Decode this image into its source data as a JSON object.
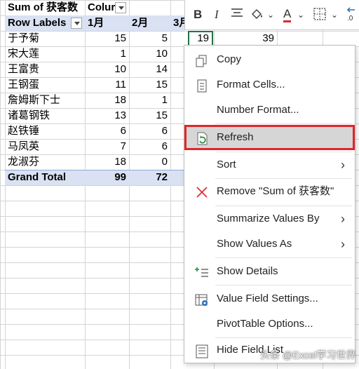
{
  "pivot": {
    "title": "Sum of 获客数",
    "column_labels": "Colur",
    "row_labels": "Row Labels",
    "columns": [
      "1月",
      "2月",
      "3月"
    ],
    "rows": [
      {
        "name": "于予菊",
        "m1": "15",
        "m2": "5"
      },
      {
        "name": "宋大莲",
        "m1": "1",
        "m2": "10"
      },
      {
        "name": "王富贵",
        "m1": "10",
        "m2": "14"
      },
      {
        "name": "王钢蛋",
        "m1": "11",
        "m2": "15"
      },
      {
        "name": "詹姆斯下士",
        "m1": "18",
        "m2": "1"
      },
      {
        "name": "诸葛钢铁",
        "m1": "13",
        "m2": "15"
      },
      {
        "name": "赵铁锤",
        "m1": "6",
        "m2": "6"
      },
      {
        "name": "马凤英",
        "m1": "7",
        "m2": "6"
      },
      {
        "name": "龙淑芬",
        "m1": "18",
        "m2": "0"
      }
    ],
    "grand_total": {
      "label": "Grand Total",
      "m1": "99",
      "m2": "72"
    },
    "extra_cells": {
      "c1": "19",
      "c2": "39"
    }
  },
  "mini_toolbar": {
    "bold": "B",
    "italic": "I",
    "font_color_letter": "A"
  },
  "context_menu": {
    "copy": "Copy",
    "format_cells": "Format Cells...",
    "number_format": "Number Format...",
    "refresh": "Refresh",
    "sort": "Sort",
    "remove": "Remove \"Sum of 获客数\"",
    "summarize": "Summarize Values By",
    "show_values_as": "Show Values As",
    "show_details": "Show Details",
    "value_field_settings": "Value Field Settings...",
    "pivot_options": "PivotTable Options...",
    "hide_field_list": "Hide Field List"
  },
  "colors": {
    "highlight_border": "#e0262b",
    "pivot_header": "#d9e1f2",
    "refresh_icon": "#2e8b3e",
    "remove_icon": "#e0262b"
  },
  "watermark": "头条 @Excel学习世界"
}
